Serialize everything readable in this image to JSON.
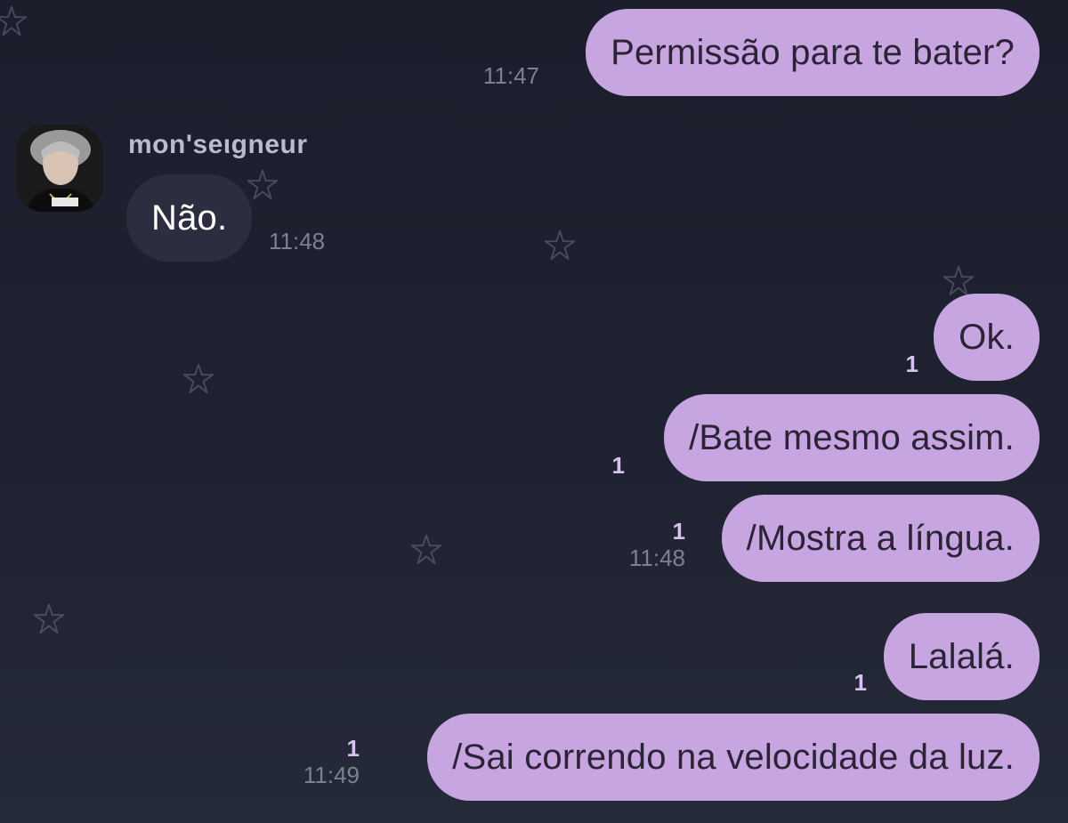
{
  "chat": {
    "contact": {
      "name": "mon'seιgneur"
    },
    "messages": [
      {
        "text": "Permissão para te bater?",
        "time": "11:47",
        "unread": ""
      },
      {
        "text": "Não.",
        "time": "11:48"
      },
      {
        "text": "Ok.",
        "time": "",
        "unread": "1"
      },
      {
        "text": "/Bate mesmo assim.",
        "time": "",
        "unread": "1"
      },
      {
        "text": "/Mostra a língua.",
        "time": "11:48",
        "unread": "1"
      },
      {
        "text": "Lalalá.",
        "time": "",
        "unread": "1"
      },
      {
        "text": "/Sai correndo na velocidade da luz.",
        "time": "11:49",
        "unread": "1"
      }
    ]
  },
  "theme": {
    "outgoing_bubble": "#c6a5e0",
    "incoming_bubble": "#2c2e40",
    "background": "#1f2231",
    "unread_color": "#d8c2ef",
    "time_color": "#7d8091"
  },
  "icons": {
    "background_decoration": "star-icon",
    "contact_photo": "avatar"
  }
}
